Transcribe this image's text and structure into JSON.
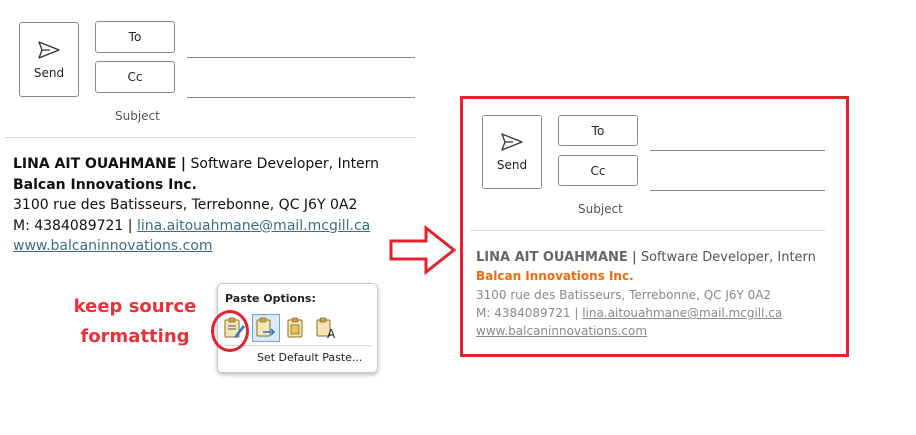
{
  "left": {
    "compose": {
      "send_label": "Send",
      "to_label": "To",
      "cc_label": "Cc",
      "subject_placeholder": "Subject"
    },
    "signature": {
      "name": "LINA AIT OUAHMANE",
      "separator": "|",
      "role": "Software Developer, Intern",
      "company": "Balcan Innovations Inc.",
      "address": "3100 rue des Batisseurs, Terrebonne, QC J6Y 0A2",
      "mobile_prefix": "M: 4384089721 |",
      "email": "lina.aitouahmane@mail.mcgill.ca",
      "website": "www.balcaninnovations.com"
    }
  },
  "annotation": {
    "line1": "keep source",
    "line2": "formatting"
  },
  "paste_popup": {
    "title": "Paste Options:",
    "icons": [
      "keep-source-formatting-icon",
      "merge-formatting-icon",
      "picture-icon",
      "keep-text-only-icon"
    ],
    "default_item": "Set Default Paste..."
  },
  "right": {
    "compose": {
      "send_label": "Send",
      "to_label": "To",
      "cc_label": "Cc",
      "subject_placeholder": "Subject"
    },
    "signature": {
      "name": "LINA AIT OUAHMANE",
      "separator": "|",
      "role": "Software Developer, Intern",
      "company": "Balcan Innovations Inc.",
      "address": "3100 rue des Batisseurs, Terrebonne, QC J6Y 0A2",
      "mobile_prefix": "M: 4384089721 |",
      "email": "lina.aitouahmane@mail.mcgill.ca",
      "website": "www.balcaninnovations.com"
    }
  },
  "colors": {
    "highlight_red": "#e3232d",
    "company_orange": "#f06a0a",
    "link_blue": "#3b6d86"
  }
}
